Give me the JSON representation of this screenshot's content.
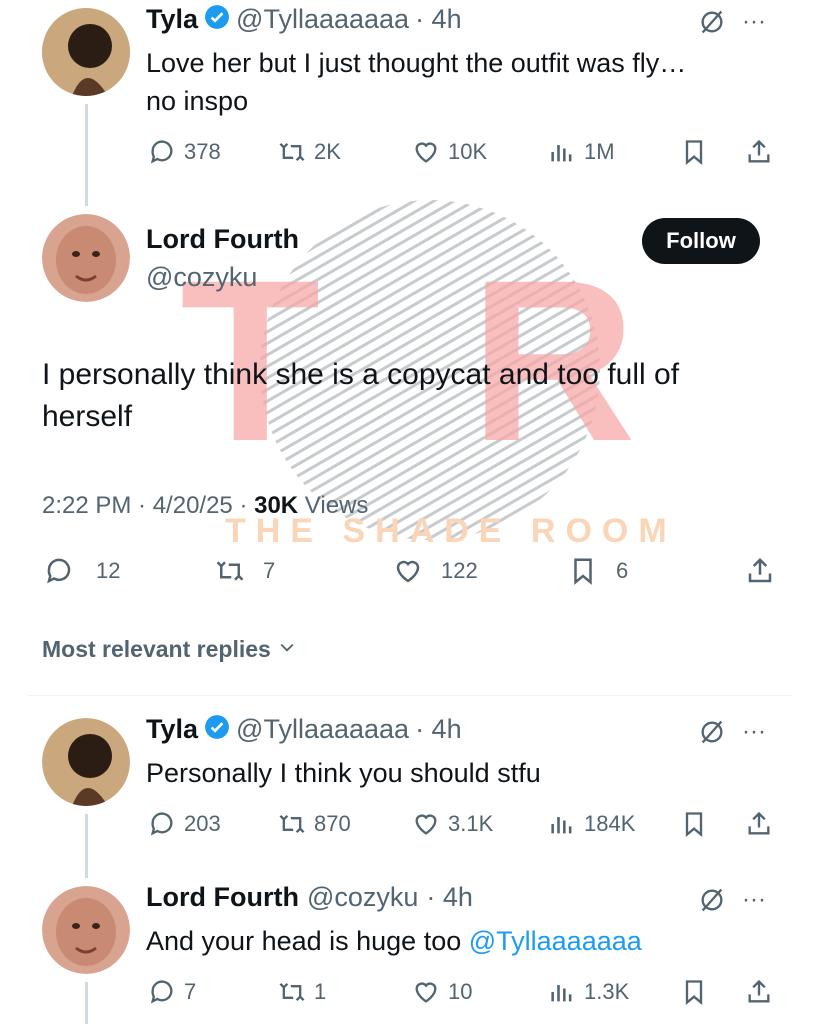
{
  "tweets": [
    {
      "name": "Tyla",
      "handle": "@Tyllaaaaaaa",
      "time": "· 4h",
      "text1": "Love her but I just thought the outfit was fly…",
      "text2": "no inspo",
      "replies": "378",
      "retweets": "2K",
      "likes": "10K",
      "views": "1M"
    },
    {
      "name": "Tyla",
      "handle": "@Tyllaaaaaaa",
      "time": "· 4h",
      "text1": "Personally I think you should stfu",
      "replies": "203",
      "retweets": "870",
      "likes": "3.1K",
      "views": "184K"
    },
    {
      "name": "Lord Fourth",
      "handle": "@cozyku",
      "time": "· 4h",
      "text1": "And your head is huge too ",
      "mention": "@Tyllaaaaaaa",
      "replies": "7",
      "retweets": "1",
      "likes": "10",
      "views": "1.3K"
    }
  ],
  "main": {
    "name": "Lord Fourth",
    "handle": "@cozyku",
    "follow_label": "Follow",
    "text1": "I personally think she is a copycat and too full of",
    "text2": "herself",
    "timestamp": "2:22 PM · 4/20/25 · ",
    "views_count": "30K",
    "views_label": " Views",
    "replies": "12",
    "retweets": "7",
    "likes": "122",
    "bookmarks": "6"
  },
  "replies_sort": {
    "label": "Most relevant replies"
  },
  "watermark": {
    "logo": "TSR",
    "subtitle": "THE SHADE ROOM"
  },
  "colors": {
    "verified": "#1d9bf0",
    "watermark_pink": "#f7b3b3",
    "watermark_orange": "#fad5b8"
  }
}
